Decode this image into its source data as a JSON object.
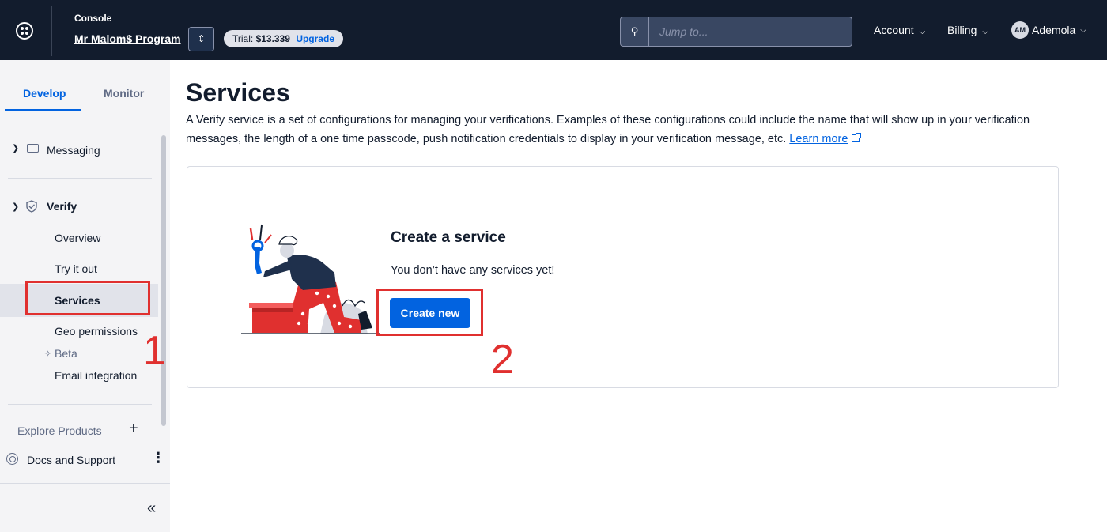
{
  "topbar": {
    "console_label": "Console",
    "account_name": "Mr Malom$ Program",
    "trial_label": "Trial:",
    "trial_balance": "$13.339",
    "upgrade_label": "Upgrade",
    "search_placeholder": "Jump to...",
    "account_menu": "Account",
    "billing_menu": "Billing",
    "user_initials": "AM",
    "user_name": "Ademola"
  },
  "sidebar": {
    "tabs": [
      {
        "label": "Develop",
        "active": true
      },
      {
        "label": "Monitor",
        "active": false
      }
    ],
    "messaging_label": "Messaging",
    "verify": {
      "label": "Verify",
      "items": [
        {
          "label": "Overview"
        },
        {
          "label": "Try it out"
        },
        {
          "label": "Services",
          "active": true
        },
        {
          "label": "Geo permissions"
        },
        {
          "label": "Email integration"
        }
      ],
      "beta_label": "Beta"
    },
    "explore_label": "Explore Products",
    "docs_label": "Docs and Support"
  },
  "main": {
    "title": "Services",
    "description": "A Verify service is a set of configurations for managing your verifications. Examples of these configurations could include the name that will show up in your verification messages, the length of a one time passcode, push notification credentials to display in your verification message, etc.",
    "learn_more": "Learn more",
    "card": {
      "title": "Create a service",
      "empty_text": "You don’t have any services yet!",
      "button_label": "Create new"
    }
  },
  "annotations": [
    "1",
    "2"
  ],
  "colors": {
    "topbar_bg": "#121c2d",
    "accent": "#0263e0",
    "annotation": "#e0302f",
    "sidebar_bg": "#f4f4f6"
  },
  "icons": {
    "logo": "twilio-logo-icon",
    "search": "search-icon",
    "messaging": "chat-bubble-icon",
    "verify": "shield-check-icon",
    "docs": "lifebuoy-icon",
    "more": "more-vertical-icon",
    "collapse": "double-chevron-left-icon"
  }
}
